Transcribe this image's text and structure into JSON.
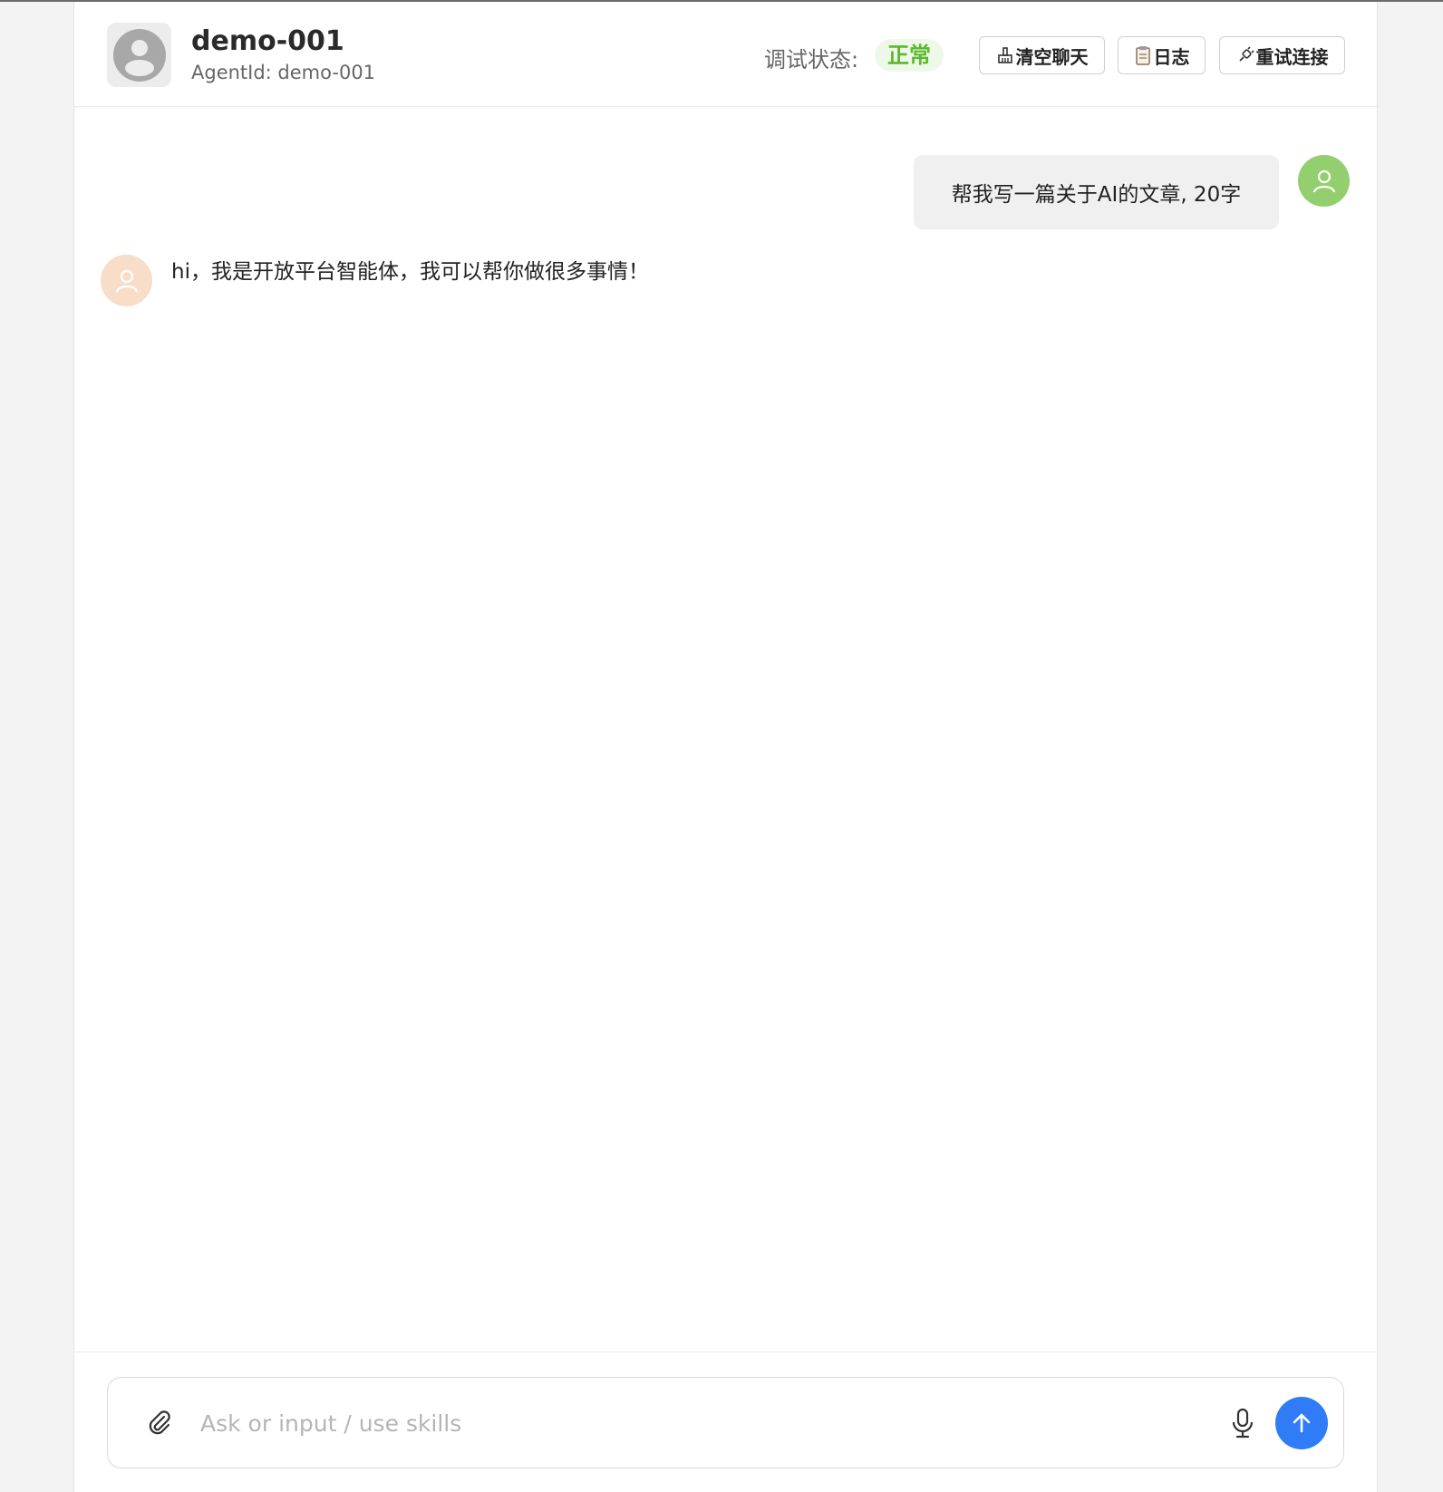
{
  "header": {
    "agent_name": "demo-001",
    "agent_id_label": "AgentId: demo-001",
    "status_label": "调试状态:",
    "status_value": "正常",
    "buttons": {
      "clear_label": "清空聊天",
      "log_label": "日志",
      "retry_label": "重试连接"
    }
  },
  "chat": {
    "messages": [
      {
        "role": "user",
        "text": "帮我写一篇关于AI的文章, 20字"
      },
      {
        "role": "assistant",
        "text": "hi，我是开放平台智能体，我可以帮你做很多事情！"
      }
    ]
  },
  "composer": {
    "placeholder": "Ask or input / use skills",
    "value": ""
  },
  "icons": {
    "agent_avatar": "person-silhouette-icon",
    "clear": "broom-icon",
    "log": "clipboard-icon",
    "retry": "plug-icon",
    "user_avatar": "user-outline-icon",
    "bot_avatar": "user-outline-icon",
    "attach": "paperclip-icon",
    "mic": "microphone-icon",
    "send": "arrow-up-icon"
  },
  "colors": {
    "status_green": "#5cb82c",
    "status_bg": "#eef8e8",
    "user_avatar": "#93cf6e",
    "bot_avatar": "#f8ddc8",
    "send_button": "#2f7cf6"
  }
}
